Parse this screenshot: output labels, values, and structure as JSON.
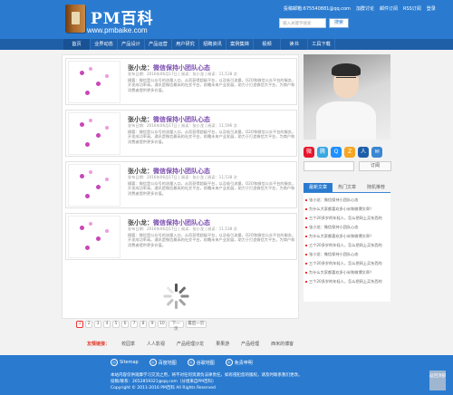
{
  "header": {
    "logo_text": "PM百科",
    "logo_url": "www.pmbaike.com",
    "top_links": [
      "投稿邮箱:675540881@qq.com",
      "加群讨论",
      "邮件订阅",
      "RSS订阅",
      "登录"
    ],
    "search_placeholder": "输入关键字搜索",
    "search_button": "搜索"
  },
  "nav": [
    "首页",
    "业界动态",
    "产品设计",
    "产品运营",
    "用户研究",
    "招聘资讯",
    "案例集锦",
    "视频",
    "读书",
    "工具下载"
  ],
  "posts": [
    {
      "title_a": "张小龙：",
      "title_b": "微信保持小团队心态",
      "meta": "发布日期：2016年06月17日  |  阅读：张小龙  |  阅读：11,538 次",
      "excerpt": "摘要：微信是公众号的流量入口，从而获得超级平台，以及吸引流量，O2O和微信公众平台的服务，开发成功率高。通讯是微信最高的社交平台，前瞻未来产业发展，助力于打造微信大平台，为商户和消费者提供更多价值。"
    },
    {
      "title_a": "张小龙：",
      "title_b": "微信保持小团队心态",
      "meta": "发布日期：2016年06月17日  |  阅读：张小龙  |  阅读：11,596 次",
      "excerpt": "摘要：微信是公众号的流量入口，从而获得超级平台，以及吸引流量，O2O和微信公众平台的服务，开发成功率高。通讯是微信最高的社交平台，前瞻未来产业发展，助力于打造微信大平台，为商户和消费者提供更多价值。"
    },
    {
      "title_a": "张小龙：",
      "title_b": "微信保持小团队心态",
      "meta": "发布日期：2016年06月17日  |  阅读：张小龙  |  阅读：11,538 次",
      "excerpt": "摘要：微信是公众号的流量入口，从而获得超级平台，以及吸引流量，O2O和微信公众平台的服务，开发成功率高。通讯是微信最高的社交平台，前瞻未来产业发展，助力于打造微信大平台，为商户和消费者提供更多价值。"
    },
    {
      "title_a": "张小龙：",
      "title_b": "微信保持小团队心态",
      "meta": "发布日期：2016年06月17日  |  阅读：张小龙  |  阅读：11,538 次",
      "excerpt": "摘要：微信是公众号的流量入口，从而获得超级平台，以及吸引流量，O2O和微信公众平台的服务，开发成功率高。通讯是微信最高的社交平台，前瞻未来产业发展，助力于打造微信大平台，为商户和消费者提供更多价值。"
    }
  ],
  "pager": {
    "pages": [
      "1",
      "2",
      "3",
      "4",
      "5",
      "6",
      "7",
      "8",
      "9",
      "10"
    ],
    "current": "1",
    "next": "下一页",
    "last": "最后一页"
  },
  "sidebar": {
    "social_icons": [
      {
        "name": "weibo-icon",
        "glyph": "微",
        "color": "#e6162d"
      },
      {
        "name": "tencent-weibo-icon",
        "glyph": "腾",
        "color": "#3aa7e0"
      },
      {
        "name": "qq-icon",
        "glyph": "Q",
        "color": "#1e90ff"
      },
      {
        "name": "qzone-icon",
        "glyph": "Z",
        "color": "#f5a623"
      },
      {
        "name": "renren-icon",
        "glyph": "人",
        "color": "#1d5ea9"
      },
      {
        "name": "mail-icon",
        "glyph": "✉",
        "color": "#3b86d2"
      }
    ],
    "subscribe_button": "订阅",
    "tabs": [
      "最新文章",
      "热门文章",
      "随机推荐"
    ],
    "list": [
      "张小龙：微信保持小团队心态",
      "为什么大家都喜欢多小米和微博文章？",
      "三个20多岁的年轻人，怎么把网上买东西的",
      "张小龙：微信保持小团队心态",
      "为什么大家都喜欢多小米和微博文章？",
      "三个20多岁的年轻人，怎么把网上买东西的",
      "张小龙：微信保持小团队心态",
      "三个20多岁的年轻人，怎么把网上买东西的",
      "为什么大家都喜欢多小米和微博文章？",
      "三个20多岁的年轻人，怎么把网上买东西的"
    ]
  },
  "friend_links": {
    "label": "友情链接：",
    "items": [
      "校园季",
      "人人影视",
      "产品经理沙龙",
      "果果游",
      "产品经理",
      "西米的博客"
    ]
  },
  "footer": {
    "icons": [
      {
        "name": "sitemap-icon",
        "label": "Sitemap"
      },
      {
        "name": "baidu-map-icon",
        "label": "百度地图"
      },
      {
        "name": "google-map-icon",
        "label": "谷歌地图"
      },
      {
        "name": "disclaimer-icon",
        "label": "免责申明"
      }
    ],
    "line1": "本站内容仅供观摩学习交流之用，将不对任何资源负法律责任，如有侵犯您的版权，请及时联系我们更改。",
    "line2": "投稿/联系：2652859321@qq.com（分组来自PM百科）",
    "line3": "Copyright © 2011-2016 PM百科 All Rights Reserved",
    "back_to_top": "返回顶部"
  }
}
